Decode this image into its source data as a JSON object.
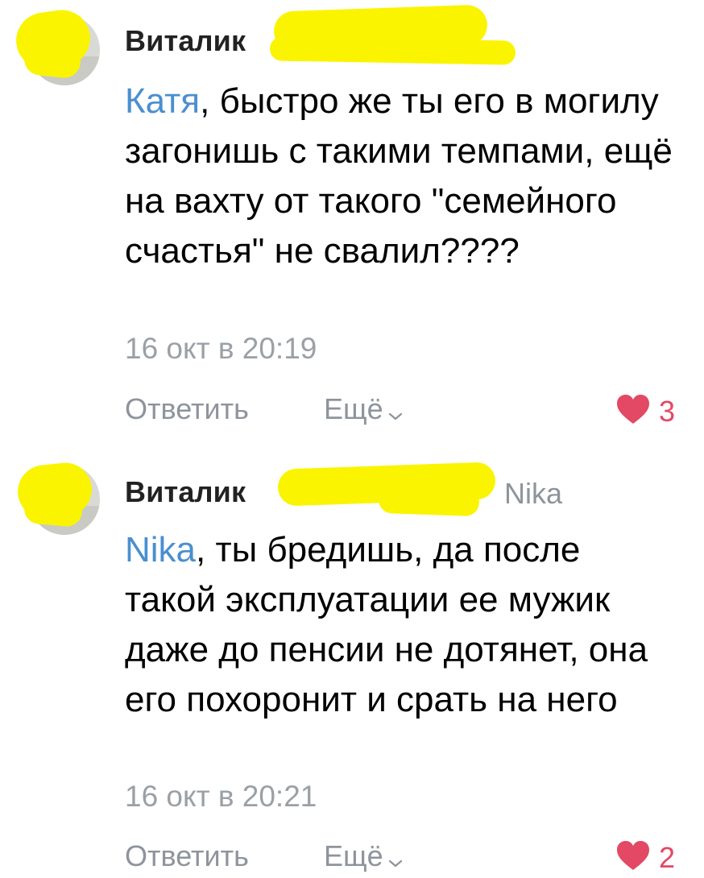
{
  "comments": [
    {
      "author": "Виталик",
      "reply_to": "",
      "mention": "Катя",
      "text": ", быстро же ты его в могилу загонишь с такими темпами, ещё на вахту от такого \"семейного счастья\" не свалил????",
      "timestamp": "16 окт в 20:19",
      "reply_label": "Ответить",
      "more_label": "Ещё",
      "like_count": "3"
    },
    {
      "author": "Виталик",
      "reply_to": "Nika",
      "mention": "Nika",
      "text": ", ты бредишь, да после такой эксплуатации ее мужик даже до пенсии не дотянет, она его похоронит и срать на него",
      "timestamp": "16 окт в 20:21",
      "reply_label": "Ответить",
      "more_label": "Ещё",
      "like_count": "2"
    }
  ],
  "colors": {
    "mention": "#4a8fd0",
    "like": "#e34964",
    "secondary": "#8d949c",
    "redaction": "#fbf400"
  }
}
